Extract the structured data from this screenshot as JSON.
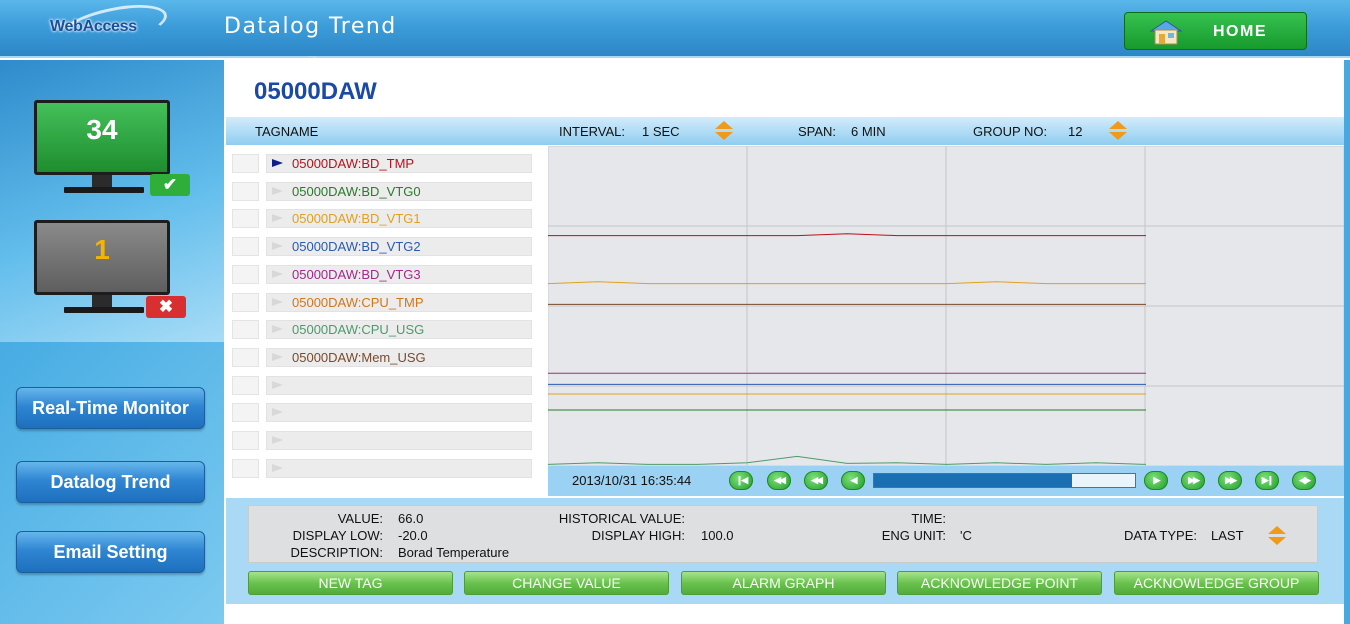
{
  "header": {
    "logo_text": "WebAccess",
    "title": "Datalog Trend",
    "home_label": "HOME"
  },
  "sidebar": {
    "monitors": [
      {
        "count": "34",
        "status": "ok",
        "screen_color": "#2aa53a",
        "badge_color": "#2faf3a",
        "badge_icon": "check-icon"
      },
      {
        "count": "1",
        "status": "error",
        "screen_color": "#7a7a7a",
        "badge_color": "#d83030",
        "badge_icon": "x-icon"
      }
    ],
    "buttons": [
      {
        "label": "Real-Time Monitor"
      },
      {
        "label": "Datalog Trend"
      },
      {
        "label": "Email Setting"
      }
    ]
  },
  "main": {
    "heading": "05000DAW",
    "column_header": {
      "tagname": "TAGNAME",
      "interval_label": "INTERVAL:",
      "interval_value": "1 SEC",
      "span_label": "SPAN:",
      "span_value": "6 MIN",
      "group_label": "GROUP NO:",
      "group_value": "12"
    },
    "tags": [
      {
        "name": "05000DAW:BD_TMP",
        "color": "#b5121b",
        "selected": true
      },
      {
        "name": "05000DAW:BD_VTG0",
        "color": "#2a7a2a",
        "selected": false
      },
      {
        "name": "05000DAW:BD_VTG1",
        "color": "#e0a020",
        "selected": false
      },
      {
        "name": "05000DAW:BD_VTG2",
        "color": "#2a5ab0",
        "selected": false
      },
      {
        "name": "05000DAW:BD_VTG3",
        "color": "#a02a8a",
        "selected": false
      },
      {
        "name": "05000DAW:CPU_TMP",
        "color": "#d2761a",
        "selected": false
      },
      {
        "name": "05000DAW:CPU_USG",
        "color": "#4d9a6a",
        "selected": false
      },
      {
        "name": "05000DAW:Mem_USG",
        "color": "#7a4a2a",
        "selected": false
      },
      {
        "name": "",
        "color": "#000000",
        "selected": false
      },
      {
        "name": "",
        "color": "#000000",
        "selected": false
      },
      {
        "name": "",
        "color": "#000000",
        "selected": false
      },
      {
        "name": "",
        "color": "#000000",
        "selected": false
      }
    ],
    "playback": {
      "timestamp": "2013/10/31 16:35:44",
      "progress": 0.76
    },
    "info": {
      "value_label": "VALUE:",
      "value": "66.0",
      "display_low_label": "DISPLAY LOW:",
      "display_low": "-20.0",
      "description_label": "DESCRIPTION:",
      "description": "Borad Temperature",
      "historical_label": "HISTORICAL VALUE:",
      "historical_value": "",
      "display_high_label": "DISPLAY HIGH:",
      "display_high": "100.0",
      "time_label": "TIME:",
      "time_value": "",
      "eng_unit_label": "ENG UNIT:",
      "eng_unit": "'C",
      "data_type_label": "DATA TYPE:",
      "data_type": "LAST"
    },
    "actions": [
      {
        "label": "NEW TAG"
      },
      {
        "label": "CHANGE VALUE"
      },
      {
        "label": "ALARM GRAPH"
      },
      {
        "label": "ACKNOWLEDGE POINT"
      },
      {
        "label": "ACKNOWLEDGE GROUP"
      }
    ]
  },
  "chart_data": {
    "type": "line",
    "x": [
      0,
      1,
      2,
      3,
      4,
      5,
      6,
      7,
      8,
      9,
      10,
      11,
      12
    ],
    "ylim": [
      0,
      100
    ],
    "grid": true,
    "series": [
      {
        "color": "#b5121b",
        "values": [
          72,
          72,
          72,
          72,
          72,
          72,
          72.6,
          72,
          72,
          72,
          72,
          72,
          72
        ]
      },
      {
        "color": "#e0a020",
        "values": [
          57,
          57.6,
          57,
          57,
          57,
          57,
          57,
          57,
          57,
          57.6,
          57,
          57,
          57
        ]
      },
      {
        "color": "#7a4a2a",
        "values": [
          50.5,
          50.5,
          50.5,
          50.5,
          50.5,
          50.5,
          50.5,
          50.5,
          50.5,
          50.5,
          50.5,
          50.5,
          50.5
        ]
      },
      {
        "color": "#a02a8a",
        "values": [
          29,
          29,
          29,
          29,
          29,
          29,
          29,
          29,
          29,
          29,
          29,
          29,
          29
        ]
      },
      {
        "color": "#2a5ab0",
        "values": [
          25.5,
          25.5,
          25.5,
          25.5,
          25.5,
          25.5,
          25.5,
          25.5,
          25.5,
          25.5,
          25.5,
          25.5,
          25.5
        ]
      },
      {
        "color": "#e0a020",
        "values": [
          22.5,
          22.5,
          22.5,
          22.5,
          22.5,
          22.5,
          22.5,
          22.5,
          22.5,
          22.5,
          22.5,
          22.5,
          22.5
        ]
      },
      {
        "color": "#2a7a2a",
        "values": [
          17.5,
          17.5,
          17.5,
          17.5,
          17.5,
          17.5,
          17.5,
          17.5,
          17.5,
          17.5,
          17.5,
          17.5,
          17.5
        ]
      },
      {
        "color": "#4d9a6a",
        "values": [
          0.5,
          1,
          0.5,
          0.5,
          1,
          3,
          0.8,
          1,
          0.5,
          1,
          0.5,
          1,
          0.5
        ]
      }
    ]
  }
}
